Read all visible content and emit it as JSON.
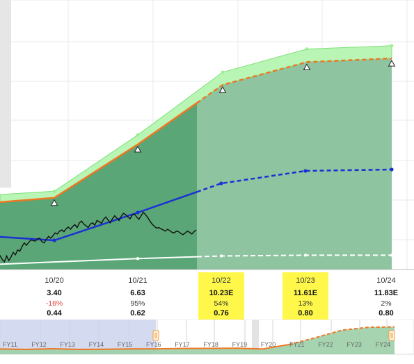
{
  "colors": {
    "earnings_area": "#5aa676",
    "earnings_area_projected": "#8fc4a0",
    "high_band": "#b9f5b4",
    "orange_line": "#ee7722",
    "price_line": "#111111",
    "blue_line": "#1a2fd6",
    "dividend_line": "#ffffff",
    "highlight": "#fff84a",
    "negative": "#e0403a",
    "navigator_window": "#ccd4ec",
    "navigator_handle": "#f39c34"
  },
  "icons": {
    "orange_marker": "triangle-icon",
    "navigator_handle": "grip-handle-icon"
  },
  "chart_data": {
    "type": "area",
    "x": [
      "10/20",
      "10/21",
      "10/22",
      "10/23",
      "10/24"
    ],
    "series": [
      {
        "values": [
          3.4,
          6.63,
          10.23,
          11.61,
          11.83
        ]
      },
      {
        "values": [
          3.8,
          7.2,
          11.0,
          12.4,
          12.6
        ]
      },
      {
        "values": [
          0.44,
          0.62,
          0.76,
          0.8,
          0.8
        ]
      }
    ],
    "price": [
      -0.15,
      -0.5,
      -0.7,
      -0.2,
      -0.6,
      -0.3,
      0.1,
      -0.1,
      0.3,
      0.2,
      0.6,
      0.9,
      0.7,
      0.95,
      1.15,
      1.1,
      1.05,
      1.25,
      1.3,
      1.0,
      0.9,
      1.2,
      1.45,
      1.3,
      1.5,
      1.75,
      1.65,
      1.9,
      2.0,
      1.85,
      2.1,
      2.25,
      2.05,
      2.3,
      2.45,
      2.2,
      2.6,
      2.75,
      2.5,
      2.35,
      2.2,
      2.5,
      2.6,
      2.4,
      2.8,
      2.7,
      2.55,
      2.9,
      3.1,
      2.85,
      2.6,
      2.95,
      3.2,
      3.0,
      2.8,
      3.15,
      3.4,
      3.3,
      3.1,
      2.95,
      3.25,
      3.35,
      3.1,
      2.9,
      3.2,
      3.5,
      3.3,
      3.05,
      2.75,
      2.5,
      2.3,
      2.15,
      2.2,
      2.1,
      2.0,
      1.9,
      2.05,
      1.95,
      1.8,
      1.75,
      1.9,
      1.85,
      1.7,
      1.6,
      1.75,
      1.9,
      1.8,
      1.65,
      1.85,
      2.0
    ],
    "navigator_ticks": [
      "FY11",
      "FY12",
      "FY13",
      "FY14",
      "FY15",
      "FY16",
      "FY17",
      "FY18",
      "FY19",
      "FY20",
      "FY21",
      "FY22",
      "FY23",
      "FY24"
    ],
    "navigator_values": [
      1.2,
      1.0,
      1.35,
      1.0,
      1.1,
      1.25,
      1.3,
      1.45,
      1.5,
      1.6,
      1.2,
      3.4,
      6.63,
      10.23,
      11.61,
      11.83
    ]
  },
  "columns": [
    {
      "date": "10/20",
      "eps": "3.40",
      "change": "-16%",
      "change_negative": true,
      "dividend": "0.44",
      "highlight": false
    },
    {
      "date": "10/21",
      "eps": "6.63",
      "change": "95%",
      "change_negative": false,
      "dividend": "0.62",
      "highlight": false
    },
    {
      "date": "10/22",
      "eps": "10.23E",
      "change": "54%",
      "change_negative": false,
      "dividend": "0.76",
      "highlight": true
    },
    {
      "date": "10/23",
      "eps": "11.61E",
      "change": "13%",
      "change_negative": false,
      "dividend": "0.80",
      "highlight": true
    },
    {
      "date": "10/24",
      "eps": "11.83E",
      "change": "2%",
      "change_negative": false,
      "dividend": "0.80",
      "highlight": false
    }
  ]
}
